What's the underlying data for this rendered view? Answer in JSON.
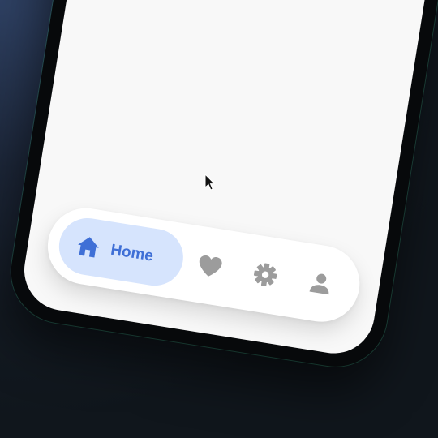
{
  "nav": {
    "items": [
      {
        "label": "Home",
        "icon": "home-icon",
        "active": true
      },
      {
        "label": "",
        "icon": "heart-icon",
        "active": false
      },
      {
        "label": "",
        "icon": "gear-icon",
        "active": false
      },
      {
        "label": "",
        "icon": "person-icon",
        "active": false
      }
    ]
  },
  "colors": {
    "accent": "#3f6fd6",
    "active_pill": "#d6e4fd",
    "inactive_icon": "#9c9c9c",
    "screen_bg": "#f8f8f8",
    "bezel": "#07090b"
  }
}
